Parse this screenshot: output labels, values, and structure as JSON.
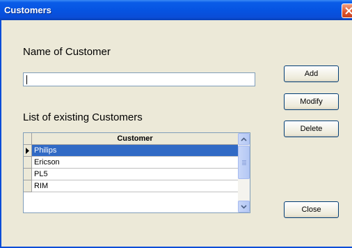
{
  "window": {
    "title": "Customers"
  },
  "form": {
    "name_label": "Name of Customer",
    "name_value": "",
    "list_label": "List of existing Customers"
  },
  "buttons": {
    "add": "Add",
    "modify": "Modify",
    "delete": "Delete",
    "close": "Close"
  },
  "grid": {
    "column_header": "Customer",
    "rows": [
      "Philips",
      "Ericson",
      "PL5",
      "RIM"
    ],
    "selected_index": 0
  },
  "colors": {
    "titlebar": "#0a5ce8",
    "selection": "#316ac5",
    "dialog_bg": "#ece9d8"
  }
}
